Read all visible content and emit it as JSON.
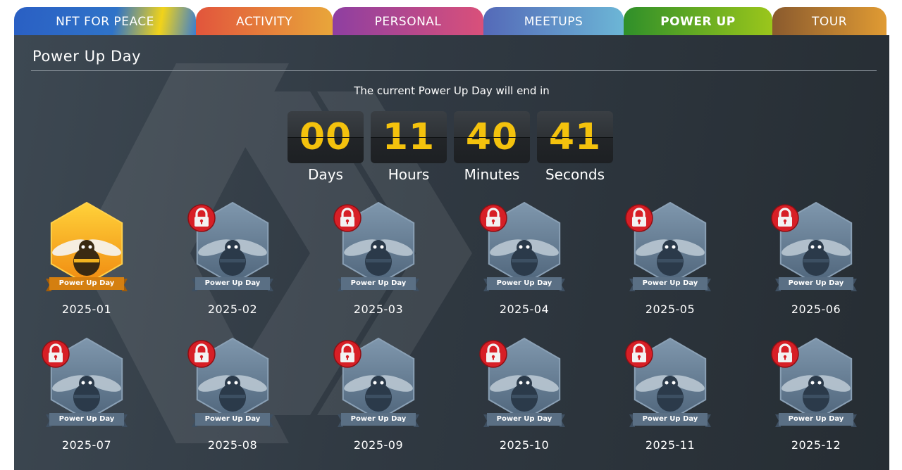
{
  "tabs": [
    {
      "label": "NFT FOR PEACE",
      "bg": "linear-gradient(100deg, #2a5fc4 0%, #2f73c8 55%, #f1d31a 80%, #3b7ed0 100%)",
      "width": 258,
      "active": false
    },
    {
      "label": "ACTIVITY",
      "bg": "linear-gradient(90deg, #e2553c, #e8a63a)",
      "width": 194,
      "active": false
    },
    {
      "label": "PERSONAL",
      "bg": "linear-gradient(90deg, #8e3fa1, #d9507a)",
      "width": 214,
      "active": false
    },
    {
      "label": "MEETUPS",
      "bg": "linear-gradient(90deg, #5469b8, #6cb6d6)",
      "width": 199,
      "active": false
    },
    {
      "label": "POWER UP",
      "bg": "linear-gradient(90deg, #2f8f2a, #9bc61b)",
      "width": 211,
      "active": true
    },
    {
      "label": "TOUR",
      "bg": "linear-gradient(90deg, #8a5a2e, #e09b33)",
      "width": 162,
      "active": false
    }
  ],
  "page": {
    "title": "Power Up Day",
    "subtitle": "The current Power Up Day will end in"
  },
  "countdown": [
    {
      "value": "00",
      "label": "Days"
    },
    {
      "value": "11",
      "label": "Hours"
    },
    {
      "value": "40",
      "label": "Minutes"
    },
    {
      "value": "41",
      "label": "Seconds"
    }
  ],
  "badge_label": "Power Up Day",
  "badges": [
    {
      "date": "2025-01",
      "locked": false
    },
    {
      "date": "2025-02",
      "locked": true
    },
    {
      "date": "2025-03",
      "locked": true
    },
    {
      "date": "2025-04",
      "locked": true
    },
    {
      "date": "2025-05",
      "locked": true
    },
    {
      "date": "2025-06",
      "locked": true
    },
    {
      "date": "2025-07",
      "locked": true
    },
    {
      "date": "2025-08",
      "locked": true
    },
    {
      "date": "2025-09",
      "locked": true
    },
    {
      "date": "2025-10",
      "locked": true
    },
    {
      "date": "2025-11",
      "locked": true
    },
    {
      "date": "2025-12",
      "locked": true
    }
  ],
  "colors": {
    "countdown_digits": "#f4c20d",
    "lock_red": "#d71f26",
    "unlocked_gold": "#f7a81b",
    "locked_steel": "#6f8aa3"
  },
  "icons": {
    "lock": "lock-icon",
    "bee": "bee-icon",
    "hive_logo": "hive-logo-icon"
  }
}
